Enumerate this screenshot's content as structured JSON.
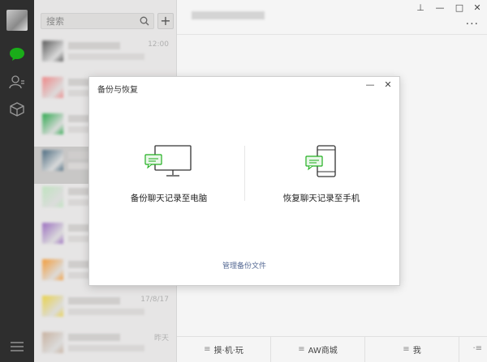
{
  "search": {
    "placeholder": "搜索"
  },
  "add_button": {
    "label": "+"
  },
  "chat_list": [
    {
      "time": "12:00",
      "avatar_color": "#5a5a5a",
      "active": false
    },
    {
      "time": "",
      "avatar_color": "#e88",
      "active": false
    },
    {
      "time": "",
      "avatar_color": "#2ea84e",
      "active": false
    },
    {
      "time": "",
      "avatar_color": "#4b6b80",
      "active": true
    },
    {
      "time": "",
      "avatar_color": "#bfe3bf",
      "active": false
    },
    {
      "time": "",
      "avatar_color": "#9b6fc0",
      "active": false
    },
    {
      "time": "",
      "avatar_color": "#f39c3a",
      "active": false
    },
    {
      "time": "17/8/17",
      "avatar_color": "#e9d24c",
      "active": false
    },
    {
      "time": "昨天",
      "avatar_color": "#c8b2a0",
      "active": false
    }
  ],
  "window_controls": {
    "pin": "⊥",
    "minimize": "—",
    "maximize": "□",
    "close": "✕"
  },
  "more_label": "···",
  "bottom_tabs": [
    {
      "label": "摸·机·玩"
    },
    {
      "label": "AW商城"
    },
    {
      "label": "我"
    }
  ],
  "dialog": {
    "title": "备份与恢复",
    "minimize": "—",
    "close": "✕",
    "backup_to_pc": "备份聊天记录至电脑",
    "restore_to_phone": "恢复聊天记录至手机",
    "manage_files": "管理备份文件"
  },
  "colors": {
    "accent": "#1aad19",
    "link": "#576b95",
    "nav_bg": "#2e2e2e"
  }
}
